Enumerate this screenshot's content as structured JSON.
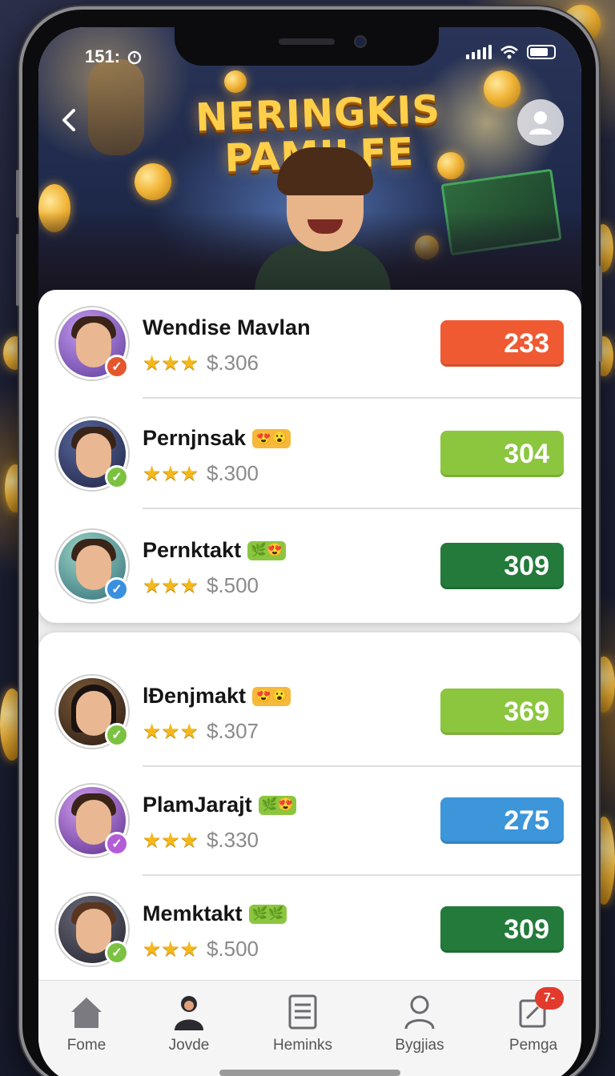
{
  "status_bar": {
    "time": "151:",
    "alarm_icon": "alarm-icon",
    "signal_icon": "signal-icon",
    "wifi_icon": "wifi-icon",
    "battery_icon": "battery-icon"
  },
  "header": {
    "title_line1": "NERINGKIS",
    "title_line2": "PAMILFE",
    "back_icon": "chevron-left-icon",
    "profile_icon": "user-icon"
  },
  "players": [
    {
      "name": "Wendise Mavlan",
      "stars": "★★★",
      "price": "$.306",
      "score": "233",
      "score_color": "#ef5a33",
      "badge_color": "#e4572e",
      "badge_icon": "check-icon",
      "tag": ""
    },
    {
      "name": "Pernjnsak",
      "stars": "★★★",
      "price": "$.300",
      "score": "304",
      "score_color": "#8cc63f",
      "badge_color": "#7cc242",
      "badge_icon": "check-icon",
      "tag": "😍😮"
    },
    {
      "name": "Pernktakt",
      "stars": "★★★",
      "price": "$.500",
      "score": "309",
      "score_color": "#237a3b",
      "badge_color": "#3a8fe0",
      "badge_icon": "check-icon",
      "tag": "🌿😍"
    },
    {
      "name": "lÐenjmakt",
      "stars": "★★★",
      "price": "$.307",
      "score": "369",
      "score_color": "#8cc63f",
      "badge_color": "#7cc242",
      "badge_icon": "check-icon",
      "tag": "😍😮"
    },
    {
      "name": "PlamJarajt",
      "stars": "★★★",
      "price": "$.330",
      "score": "275",
      "score_color": "#3d95da",
      "badge_color": "#b45cd8",
      "badge_icon": "check-icon",
      "tag": "🌿😍"
    },
    {
      "name": "Memktakt",
      "stars": "★★★",
      "price": "$.500",
      "score": "309",
      "score_color": "#237a3b",
      "badge_color": "#7cc242",
      "badge_icon": "check-icon",
      "tag": "🌿🌿"
    }
  ],
  "tabbar": {
    "tabs": [
      {
        "label": "Fome",
        "icon": "home-icon"
      },
      {
        "label": "Jovde",
        "icon": "person-icon"
      },
      {
        "label": "Heminks",
        "icon": "document-icon"
      },
      {
        "label": "Bygjias",
        "icon": "user-icon"
      },
      {
        "label": "Pemga",
        "icon": "edit-icon",
        "badge": "7-"
      }
    ]
  }
}
